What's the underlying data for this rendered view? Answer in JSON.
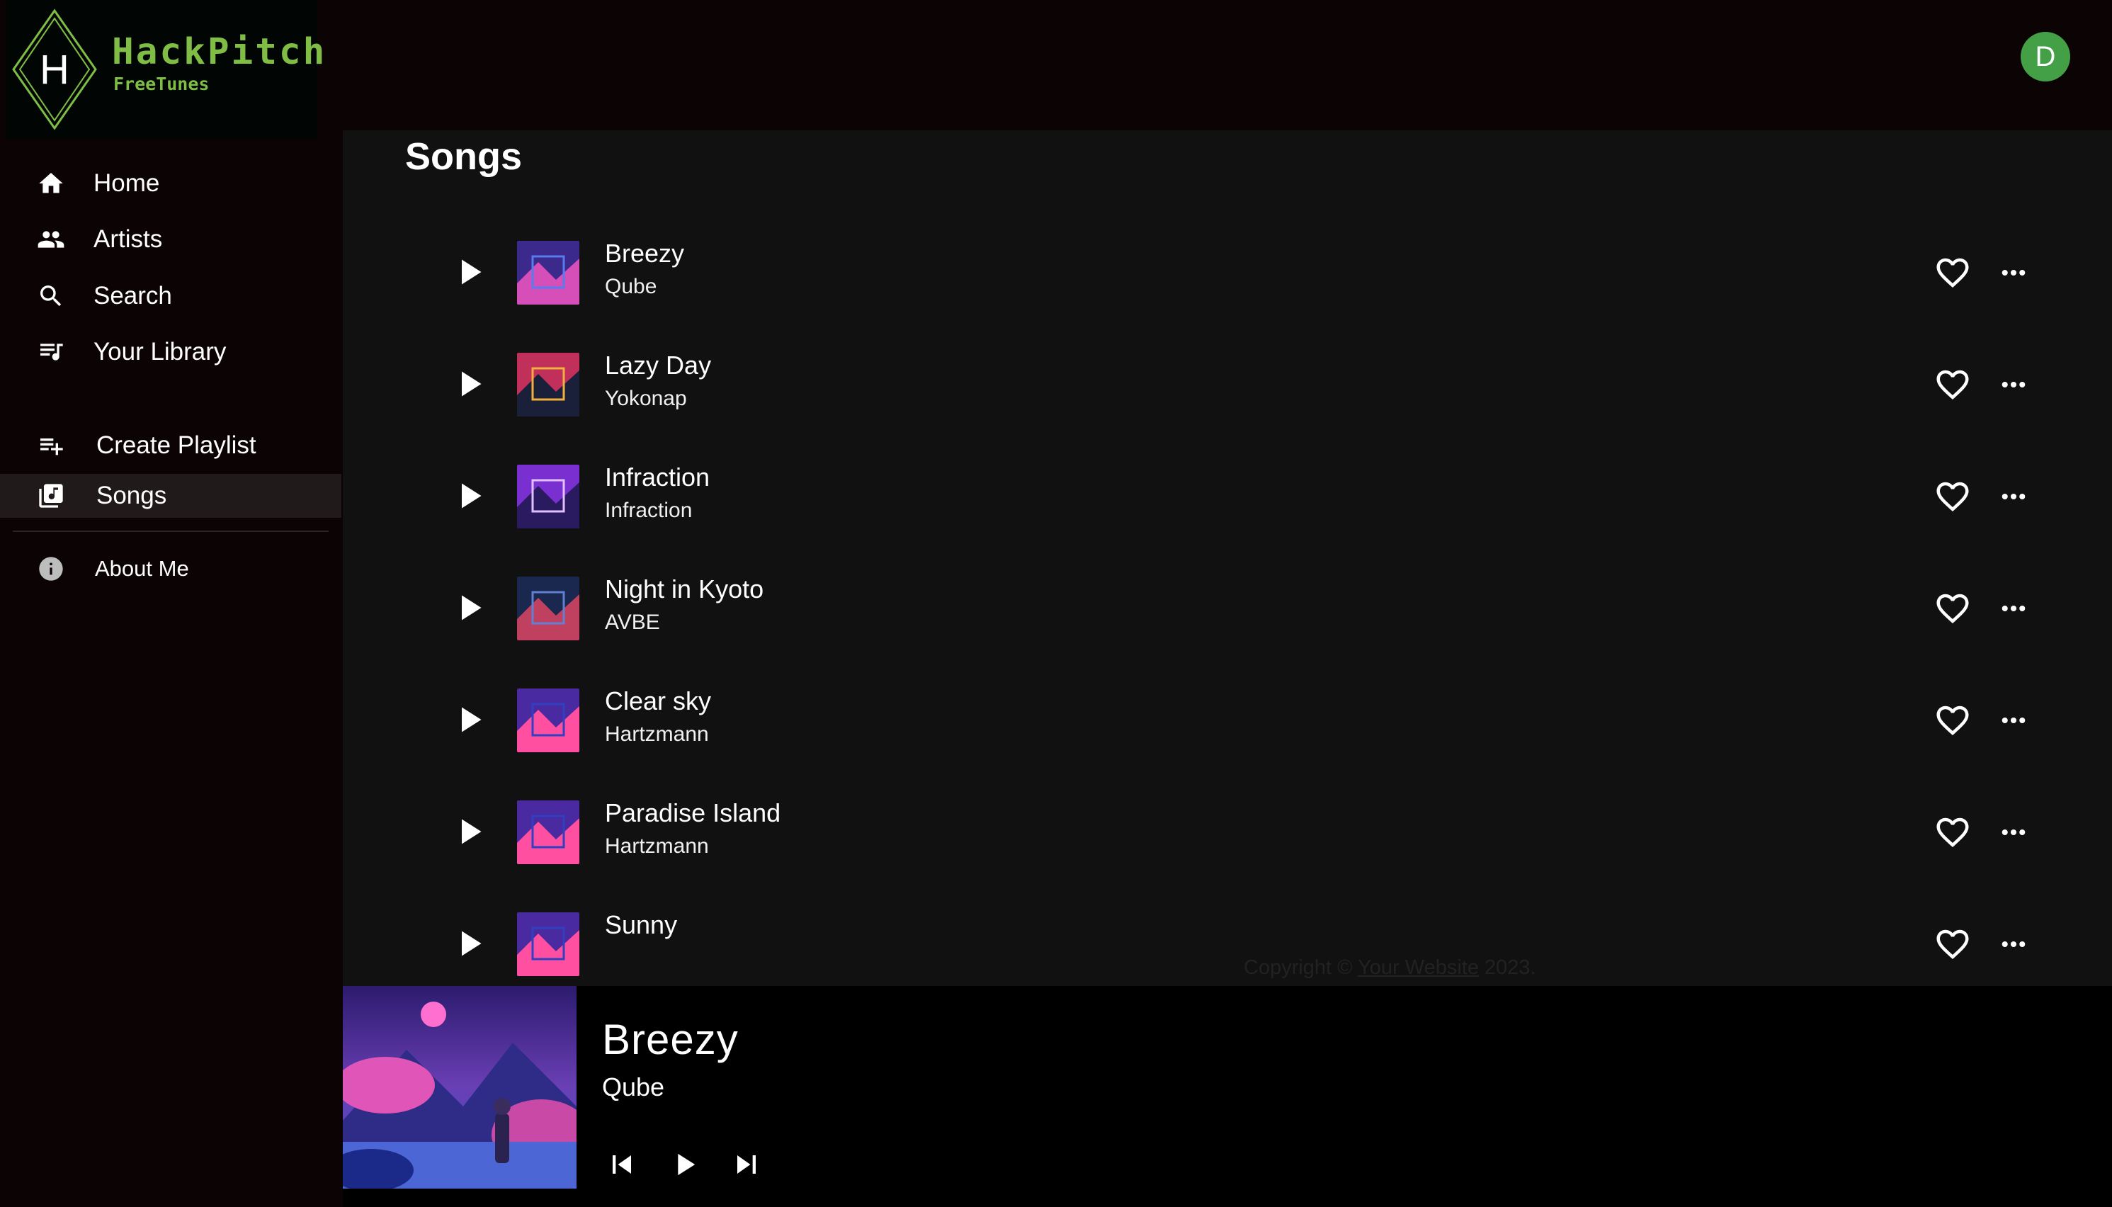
{
  "brand": {
    "logo_letter": "H",
    "name": "HackPitch",
    "subtitle": "FreeTunes"
  },
  "sidebar": {
    "nav": [
      {
        "label": "Home",
        "icon": "home-icon"
      },
      {
        "label": "Artists",
        "icon": "people-icon"
      },
      {
        "label": "Search",
        "icon": "search-icon"
      },
      {
        "label": "Your Library",
        "icon": "library-icon"
      }
    ],
    "secondary": [
      {
        "label": "Create Playlist",
        "icon": "playlist-add-icon"
      },
      {
        "label": "Songs",
        "icon": "library-music-icon",
        "active": true
      }
    ],
    "about": {
      "label": "About Me",
      "icon": "info-icon"
    }
  },
  "user": {
    "avatar_initial": "D",
    "avatar_color": "#43a047"
  },
  "main": {
    "title": "Songs",
    "songs": [
      {
        "title": "Breezy",
        "artist": "Qube"
      },
      {
        "title": "Lazy Day",
        "artist": "Yokonap"
      },
      {
        "title": "Infraction",
        "artist": "Infraction"
      },
      {
        "title": "Night in Kyoto",
        "artist": "AVBE"
      },
      {
        "title": "Clear sky",
        "artist": "Hartzmann"
      },
      {
        "title": "Paradise Island",
        "artist": "Hartzmann"
      },
      {
        "title": "Sunny",
        "artist": ""
      }
    ],
    "footer": {
      "prefix": "Copyright ©",
      "link": "Your Website",
      "year": "2023."
    }
  },
  "player": {
    "title": "Breezy",
    "artist": "Qube"
  },
  "colors": {
    "background": "#0c0305",
    "content": "#111111",
    "accent": "#7fbd45",
    "active_item": "#201a1b"
  }
}
